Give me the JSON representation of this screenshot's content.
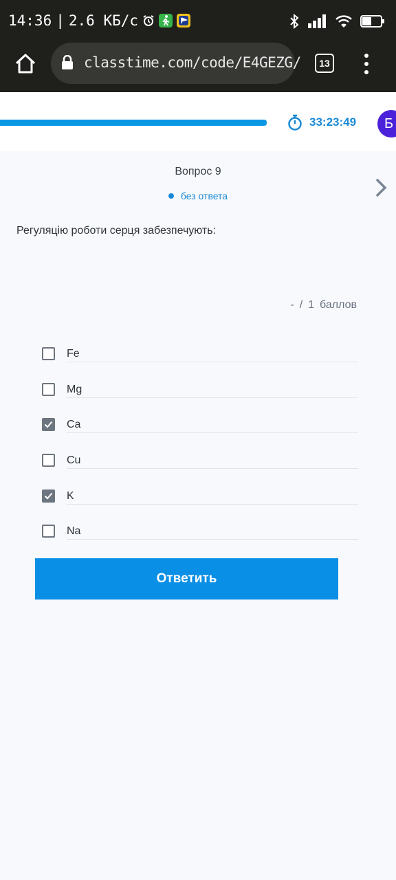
{
  "status_bar": {
    "time": "14:36",
    "separator": "|",
    "speed": "2.6 КБ/с",
    "battery": "46"
  },
  "browser": {
    "url": "classtime.com/code/E4GEZG/",
    "tab_count": "13"
  },
  "header": {
    "progress_fraction": 1.0,
    "timer": "33:23:49",
    "avatar_letter": "Б"
  },
  "question": {
    "title": "Вопрос 9",
    "status": "без ответа",
    "text": "Регуляцію роботи серця забезпечують:",
    "score": {
      "dash": "-",
      "slash": "/",
      "points": "1",
      "unit": "баллов"
    },
    "options": [
      {
        "label": "Fe",
        "checked": false
      },
      {
        "label": "Mg",
        "checked": false
      },
      {
        "label": "Ca",
        "checked": true
      },
      {
        "label": "Cu",
        "checked": false
      },
      {
        "label": "K",
        "checked": true
      },
      {
        "label": "Na",
        "checked": false
      }
    ],
    "submit_label": "Ответить"
  },
  "colors": {
    "accent": "#0a8fe6",
    "avatar": "#4b22d9",
    "checkbox": "#6d7580"
  }
}
